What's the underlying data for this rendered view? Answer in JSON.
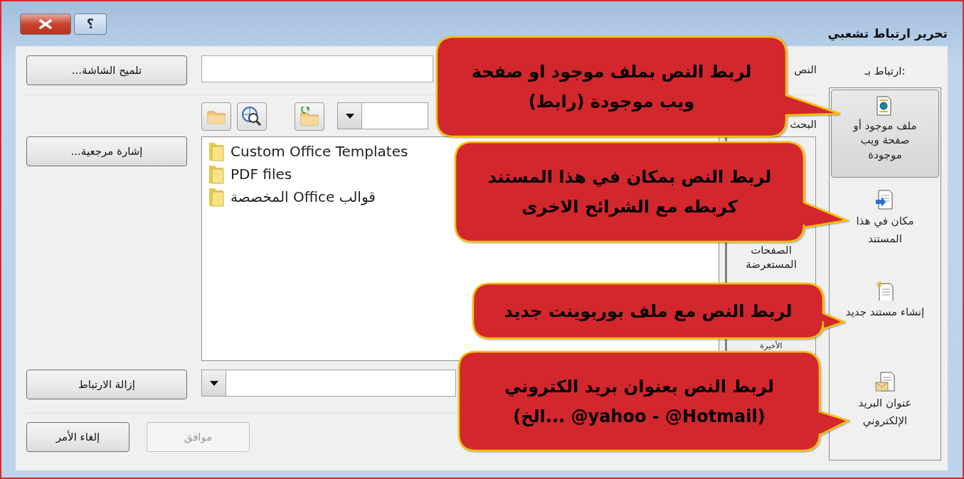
{
  "window": {
    "title": "تحرير ارتباط تشعبي",
    "help_label": "؟"
  },
  "link_to": {
    "label": "ارتباط بـ:",
    "items": [
      {
        "kind": "existing_file",
        "label": "ملف موجود أو صفحة ويب موجودة",
        "selected": true
      },
      {
        "kind": "this_document",
        "label": "مكان في هذا المستند",
        "selected": false
      },
      {
        "kind": "new_document",
        "label": "إنشاء مستند جديد",
        "selected": false
      },
      {
        "kind": "email",
        "label": "عنوان البريد الإلكتروني",
        "selected": false
      }
    ]
  },
  "text_to_display": {
    "label": "النص"
  },
  "look_in": {
    "label": "البحث"
  },
  "side_tabs": [
    {
      "label": "الصفحات المستعرضة"
    },
    {
      "label": "الأخيرة"
    }
  ],
  "files": [
    {
      "name": "Custom Office Templates"
    },
    {
      "name": "PDF files"
    },
    {
      "name": "قوالب Office المخصصة"
    }
  ],
  "buttons": [
    {
      "kind": "screen_tip",
      "label": "تلميح الشاشة...",
      "disabled": false
    },
    {
      "kind": "bookmark",
      "label": "إشارة مرجعية...",
      "disabled": false
    },
    {
      "kind": "remove_link",
      "label": "إزالة الارتباط",
      "disabled": false
    },
    {
      "kind": "cancel",
      "label": "إلغاء الأمر",
      "disabled": false
    },
    {
      "kind": "ok",
      "label": "موافق",
      "disabled": true
    }
  ],
  "callouts": [
    {
      "lines": [
        "لربط النص بملف موجود او صفحة",
        "ويب موجودة (رابط)"
      ]
    },
    {
      "lines": [
        "لربط النص بمكان في هذا المستند",
        "كربطه مع الشرائح الاخرى"
      ]
    },
    {
      "lines": [
        "لربط النص مع ملف بوربوينت جديد"
      ]
    },
    {
      "lines": [
        "لربط النص بعنوان بريد الكتروني",
        "(‎@Hotmail‏ - ‎@yahoo‏ ...الخ)"
      ]
    }
  ]
}
